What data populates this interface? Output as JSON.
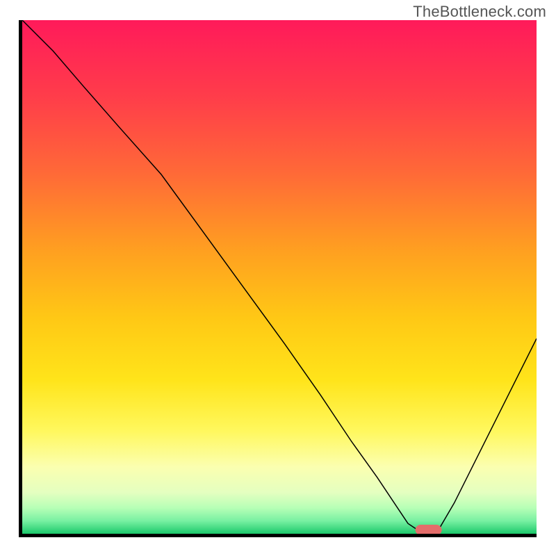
{
  "watermark": "TheBottleneck.com",
  "chart_data": {
    "type": "line",
    "title": "",
    "xlabel": "",
    "ylabel": "",
    "xlim": [
      0,
      100
    ],
    "ylim": [
      0,
      100
    ],
    "series": [
      {
        "name": "curve",
        "x": [
          0,
          6,
          12,
          19,
          27,
          35,
          43,
          51,
          58,
          64,
          69,
          73,
          75,
          78,
          80.5,
          84,
          88,
          92,
          96,
          100
        ],
        "values": [
          100,
          94,
          87,
          79,
          70,
          59,
          48,
          37,
          27,
          18,
          11,
          5,
          2,
          0,
          0,
          6,
          14,
          22,
          30,
          38
        ]
      }
    ],
    "marker": {
      "x": 79,
      "y": 0
    },
    "gradient_bands": [
      {
        "stop": 0.0,
        "color": "#ff1a5a"
      },
      {
        "stop": 0.15,
        "color": "#ff3d4a"
      },
      {
        "stop": 0.3,
        "color": "#ff6a37"
      },
      {
        "stop": 0.45,
        "color": "#ffa020"
      },
      {
        "stop": 0.58,
        "color": "#ffc815"
      },
      {
        "stop": 0.7,
        "color": "#ffe41a"
      },
      {
        "stop": 0.8,
        "color": "#fff85e"
      },
      {
        "stop": 0.87,
        "color": "#fbffb0"
      },
      {
        "stop": 0.92,
        "color": "#e4ffc0"
      },
      {
        "stop": 0.95,
        "color": "#b6ffb6"
      },
      {
        "stop": 0.975,
        "color": "#78f0a2"
      },
      {
        "stop": 1.0,
        "color": "#1cc96b"
      }
    ]
  }
}
